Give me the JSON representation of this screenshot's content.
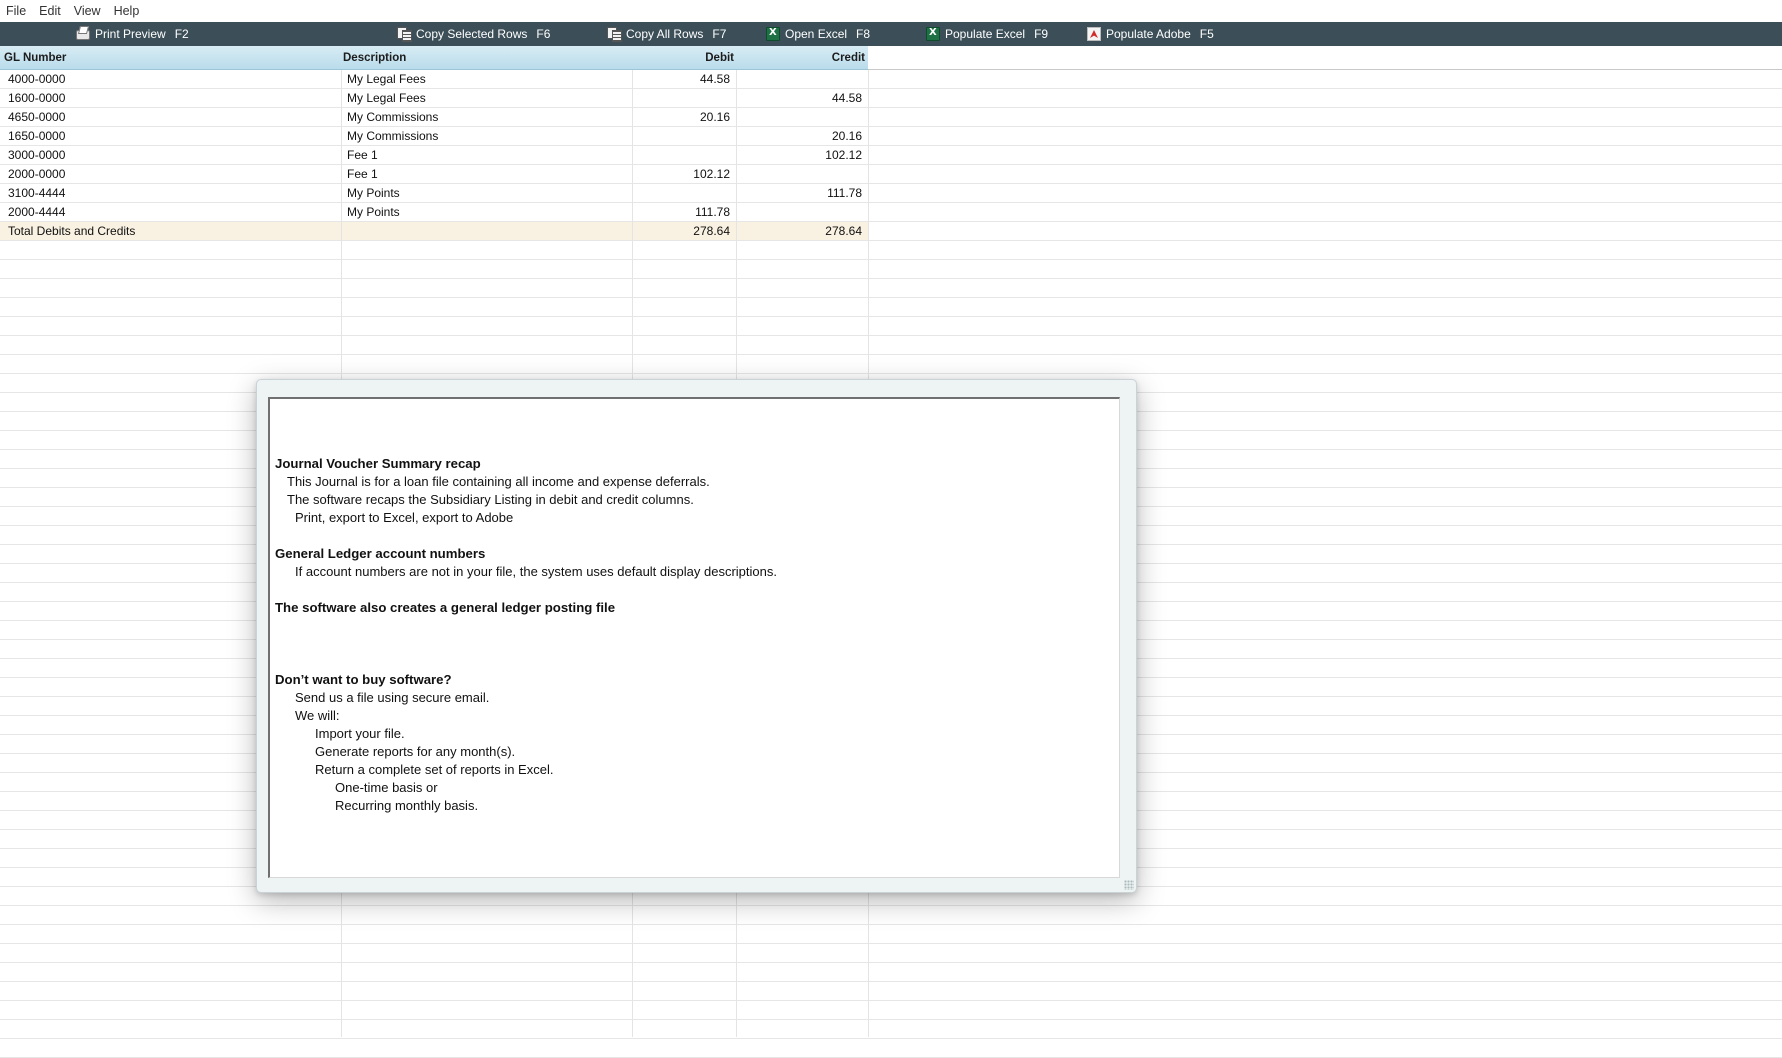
{
  "menu": [
    "File",
    "Edit",
    "View",
    "Help"
  ],
  "toolbar": [
    {
      "icon": "printer-icon",
      "label": "Print Preview",
      "key": "F2"
    },
    {
      "icon": "copy-rows-icon",
      "label": "Copy Selected Rows",
      "key": "F6"
    },
    {
      "icon": "copy-rows-icon",
      "label": "Copy All Rows",
      "key": "F7"
    },
    {
      "icon": "excel-icon",
      "label": "Open Excel",
      "key": "F8"
    },
    {
      "icon": "excel-icon",
      "label": "Populate Excel",
      "key": "F9"
    },
    {
      "icon": "adobe-icon",
      "label": "Populate Adobe",
      "key": "F5"
    }
  ],
  "table": {
    "columns": [
      "GL Number",
      "Description",
      "Debit",
      "Credit"
    ],
    "rows": [
      {
        "gl": "4000-0000",
        "desc": "My Legal Fees",
        "debit": "44.58",
        "credit": ""
      },
      {
        "gl": "1600-0000",
        "desc": "My Legal Fees",
        "debit": "",
        "credit": "44.58"
      },
      {
        "gl": "4650-0000",
        "desc": "My Commissions",
        "debit": "20.16",
        "credit": ""
      },
      {
        "gl": "1650-0000",
        "desc": "My Commissions",
        "debit": "",
        "credit": "20.16"
      },
      {
        "gl": "3000-0000",
        "desc": "Fee 1",
        "debit": "",
        "credit": "102.12"
      },
      {
        "gl": "2000-0000",
        "desc": "Fee 1",
        "debit": "102.12",
        "credit": ""
      },
      {
        "gl": "3100-4444",
        "desc": "My Points",
        "debit": "",
        "credit": "111.78"
      },
      {
        "gl": "2000-4444",
        "desc": "My Points",
        "debit": "111.78",
        "credit": ""
      }
    ],
    "total": {
      "label": "Total Debits and Credits",
      "debit": "278.64",
      "credit": "278.64"
    }
  },
  "popup": {
    "lines": [
      {
        "text": "Journal Voucher Summary recap",
        "bold": true
      },
      {
        "text": "This Journal is for a loan file containing all income and expense deferrals."
      },
      {
        "text": "The software recaps the Subsidiary Listing in debit and credit columns."
      },
      {
        "text": "Print, export to Excel, export to Adobe"
      },
      {
        "text": "General Ledger account numbers",
        "bold": true
      },
      {
        "text": "If account numbers are not in your file, the system uses default display descriptions."
      },
      {
        "text": "The software also creates a general ledger posting file",
        "bold": true
      },
      {
        "text": "Don’t want to buy software?",
        "bold": true
      },
      {
        "text": "Send us a file using secure email."
      },
      {
        "text": "We will:"
      },
      {
        "text": "Import your file."
      },
      {
        "text": "Generate reports for any month(s)."
      },
      {
        "text": "Return a complete set of reports in Excel."
      },
      {
        "text": "One-time basis or"
      },
      {
        "text": "Recurring monthly basis."
      }
    ]
  }
}
